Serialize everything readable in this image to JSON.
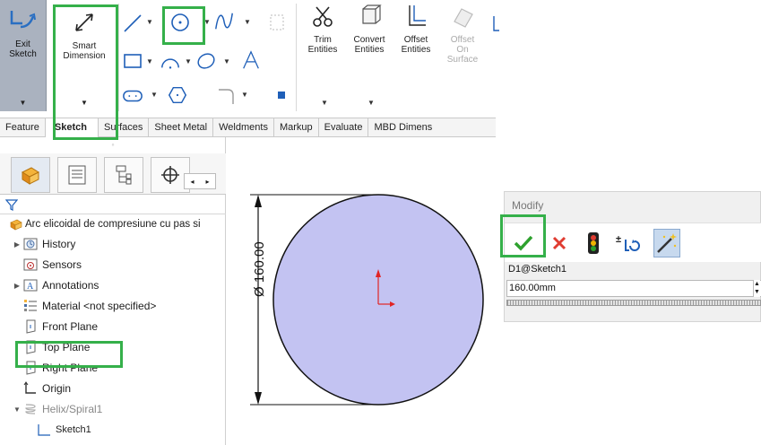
{
  "ribbon": {
    "exit_sketch": "Exit\nSketch",
    "smart_dimension": "Smart\nDimension",
    "trim_entities": "Trim\nEntities",
    "convert_entities": "Convert\nEntities",
    "offset_entities": "Offset\nEntities",
    "offset_on_surface": "Offset\nOn\nSurface"
  },
  "tabs": [
    "Feature",
    "Sketch",
    "Surfaces",
    "Sheet Metal",
    "Weldments",
    "Markup",
    "Evaluate",
    "MBD Dimens"
  ],
  "active_tab": "Sketch",
  "tree": {
    "root": "Arc elicoidal de compresiune cu pas si",
    "items": [
      {
        "label": "History",
        "expandable": true,
        "icon": "history-folder-icon"
      },
      {
        "label": "Sensors",
        "expandable": false,
        "icon": "sensors-icon"
      },
      {
        "label": "Annotations",
        "expandable": true,
        "icon": "annotations-icon"
      },
      {
        "label": "Material <not specified>",
        "expandable": false,
        "icon": "material-icon"
      },
      {
        "label": "Front Plane",
        "expandable": false,
        "icon": "plane-icon"
      },
      {
        "label": "Top Plane",
        "expandable": false,
        "icon": "plane-icon"
      },
      {
        "label": "Right Plane",
        "expandable": false,
        "icon": "plane-icon"
      },
      {
        "label": "Origin",
        "expandable": false,
        "icon": "origin-icon"
      },
      {
        "label": "Helix/Spiral1",
        "expandable": true,
        "expanded": true,
        "icon": "helix-icon"
      },
      {
        "label": "Sketch1",
        "expandable": false,
        "icon": "sketch-icon"
      }
    ]
  },
  "drawing": {
    "dimension_text": "Ø 160.00",
    "circle_fill": "#c3c3f2"
  },
  "modify": {
    "title": "Modify",
    "dimension_name": "D1@Sketch1",
    "value": "160.00mm"
  },
  "colors": {
    "highlight": "#35b04a",
    "accept": "#2ea12e",
    "reject": "#e03c31"
  }
}
